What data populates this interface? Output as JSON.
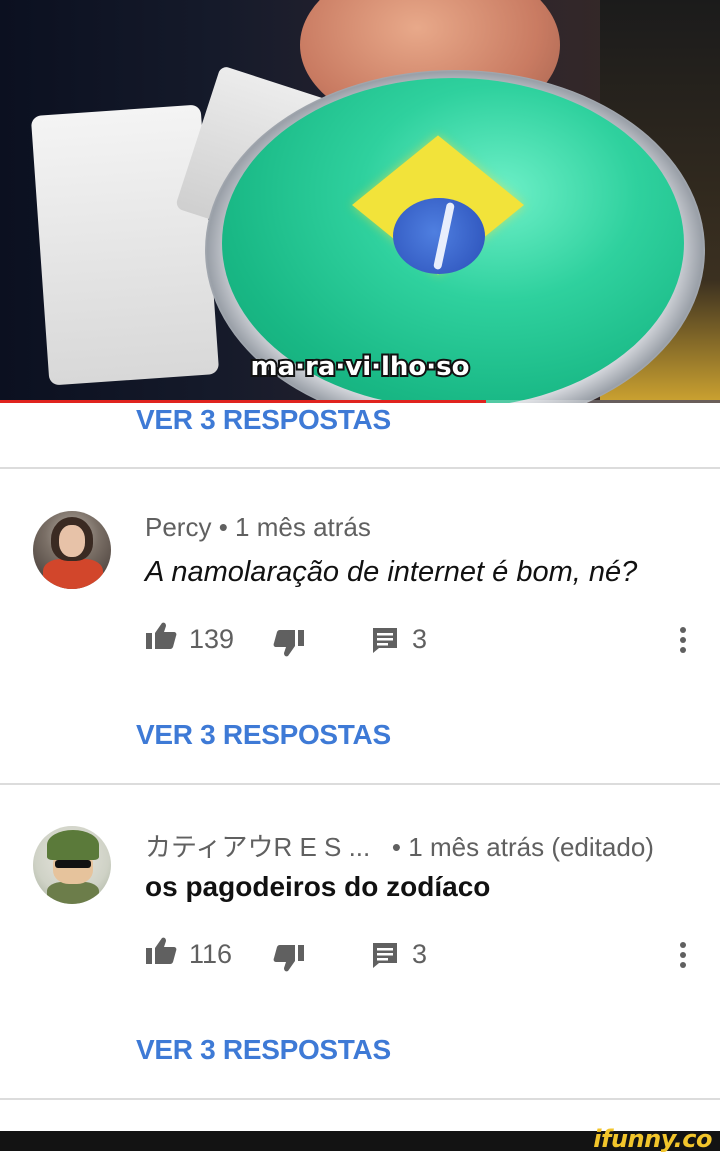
{
  "video": {
    "subtitle": "ma·ra·vi·lho·so",
    "progress_fraction": 0.675,
    "progress_color": "#e0231e"
  },
  "comments": [
    {
      "replies_link": "VER 3 RESPOSTAS"
    },
    {
      "author": "Percy",
      "separator": "•",
      "time": "1 mês atrás",
      "text": "A namolaração de internet é bom, né?",
      "likes": "139",
      "replies_count": "3",
      "replies_link": "VER 3 RESPOSTAS",
      "avatar_icon": "user-avatar-percy"
    },
    {
      "author": "カティアウR E S ...",
      "separator": "•",
      "time": "1 mês atrás (editado)",
      "text": "os pagodeiros do zodíaco",
      "likes": "116",
      "replies_count": "3",
      "replies_link": "VER 3 RESPOSTAS",
      "avatar_icon": "user-avatar-soldier"
    }
  ],
  "icons": {
    "like": "thumbs-up-icon",
    "dislike": "thumbs-down-icon",
    "reply": "comment-icon",
    "more": "more-vert-icon"
  },
  "colors": {
    "link": "#3e7ad6",
    "meta": "#606060",
    "divider": "#dcdcdc"
  },
  "watermark": {
    "text": "ifunny.co",
    "color": "#f2c52b"
  }
}
